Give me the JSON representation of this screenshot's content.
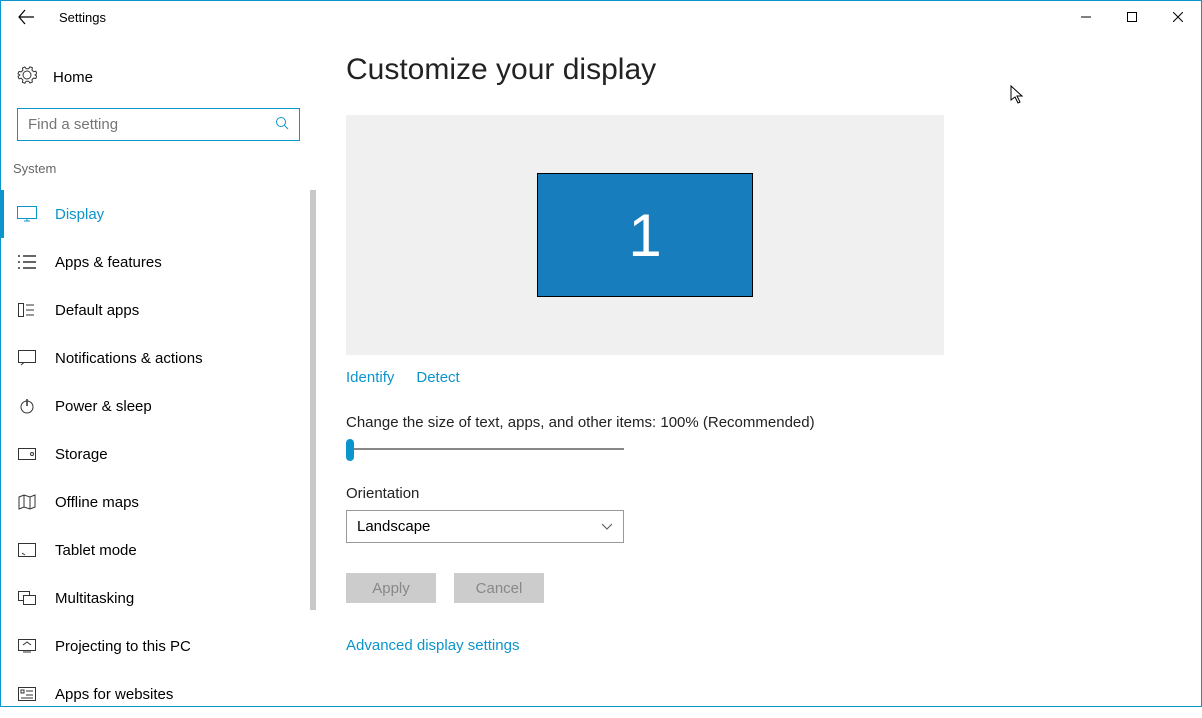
{
  "window_title": "Settings",
  "home_label": "Home",
  "search_placeholder": "Find a setting",
  "category": "System",
  "nav": {
    "items": [
      {
        "label": "Display"
      },
      {
        "label": "Apps & features"
      },
      {
        "label": "Default apps"
      },
      {
        "label": "Notifications & actions"
      },
      {
        "label": "Power & sleep"
      },
      {
        "label": "Storage"
      },
      {
        "label": "Offline maps"
      },
      {
        "label": "Tablet mode"
      },
      {
        "label": "Multitasking"
      },
      {
        "label": "Projecting to this PC"
      },
      {
        "label": "Apps for websites"
      }
    ]
  },
  "main": {
    "heading": "Customize your display",
    "monitor_number": "1",
    "identify_label": "Identify",
    "detect_label": "Detect",
    "scale_label": "Change the size of text, apps, and other items: 100% (Recommended)",
    "orientation_label": "Orientation",
    "orientation_value": "Landscape",
    "apply_label": "Apply",
    "cancel_label": "Cancel",
    "advanced_link": "Advanced display settings"
  }
}
